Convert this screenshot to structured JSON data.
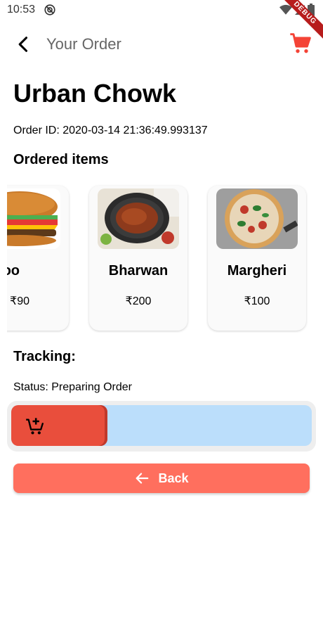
{
  "status_bar": {
    "time": "10:53",
    "sync_icon": "sync-off-icon",
    "icons": [
      "wifi-icon",
      "signal-icon",
      "battery-icon"
    ]
  },
  "debug_banner": "DEBUG",
  "app_bar": {
    "title": "Your Order",
    "back_icon": "arrow-back-icon",
    "cart_icon": "shopping-cart-icon",
    "accent": "#f44336"
  },
  "restaurant_name": "Urban Chowk",
  "order_id": "Order ID: 2020-03-14 21:36:49.993137",
  "ordered_items_heading": "Ordered items",
  "items": [
    {
      "name": "Aloo",
      "price": "₹90",
      "image": "burger"
    },
    {
      "name": "Bharwan",
      "price": "₹200",
      "image": "curry"
    },
    {
      "name": "Margheri",
      "price": "₹100",
      "image": "pizza"
    }
  ],
  "tracking": {
    "heading": "Tracking:",
    "status": "Status: Preparing Order",
    "progress": 0.32,
    "icon": "add-shopping-cart-icon",
    "colors": {
      "fill": "#e94e3c",
      "track": "#bbdefb"
    }
  },
  "back_button": {
    "label": "Back",
    "icon": "arrow-back-icon",
    "color": "#ff6f5e"
  }
}
